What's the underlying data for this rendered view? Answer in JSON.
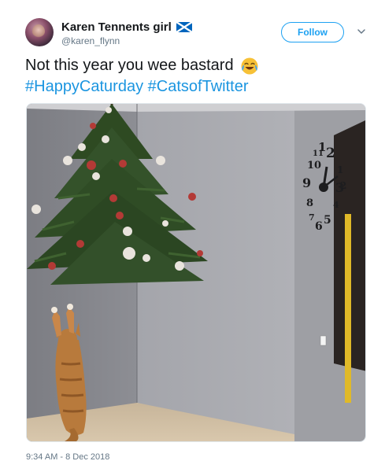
{
  "author": {
    "display_name": "Karen Tennents girl",
    "handle": "@karen_flynn",
    "flag_icon": "scotland-flag-icon"
  },
  "actions": {
    "follow_label": "Follow",
    "menu_icon": "chevron-down-icon"
  },
  "tweet": {
    "text": "Not this year you wee bastard",
    "emoji": "tears-of-joy-emoji",
    "hashtags": [
      "#HappyCaturday",
      "#CatsofTwitter"
    ]
  },
  "media": {
    "clock_numerals": [
      "12",
      "1",
      "2",
      "3",
      "4",
      "5",
      "6",
      "7",
      "8",
      "9",
      "10",
      "11"
    ]
  },
  "meta": {
    "timestamp": "9:34 AM - 8 Dec 2018"
  },
  "colors": {
    "link": "#1b95e0",
    "follow_border": "#1da1f2",
    "secondary_text": "#657786"
  }
}
